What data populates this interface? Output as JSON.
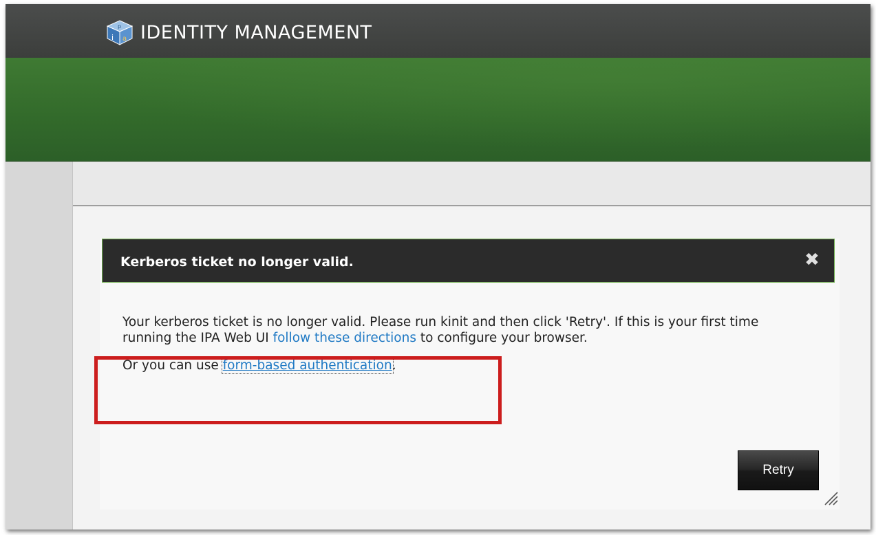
{
  "app": {
    "title": "IDENTITY MANAGEMENT",
    "logo_icon": "ipa-cube-logo-icon"
  },
  "dialog": {
    "title": "Kerberos ticket no longer valid.",
    "close_icon": "close-icon",
    "message_part1": "Your kerberos ticket is no longer valid. Please run kinit and then click 'Retry'. If this is your first time running the IPA Web UI ",
    "directions_link": "follow these directions",
    "message_part2": " to configure your browser.",
    "alt_prefix": "Or you can use ",
    "form_auth_link": "form-based authentication",
    "alt_suffix": ".",
    "retry_label": "Retry",
    "resize_icon": "resize-grip-icon"
  },
  "colors": {
    "header_dark": "#3f413f",
    "banner_green": "#3a7530",
    "dialog_header": "#2b2b2b",
    "link": "#1f79c4",
    "highlight_red": "#cc1d1d"
  }
}
